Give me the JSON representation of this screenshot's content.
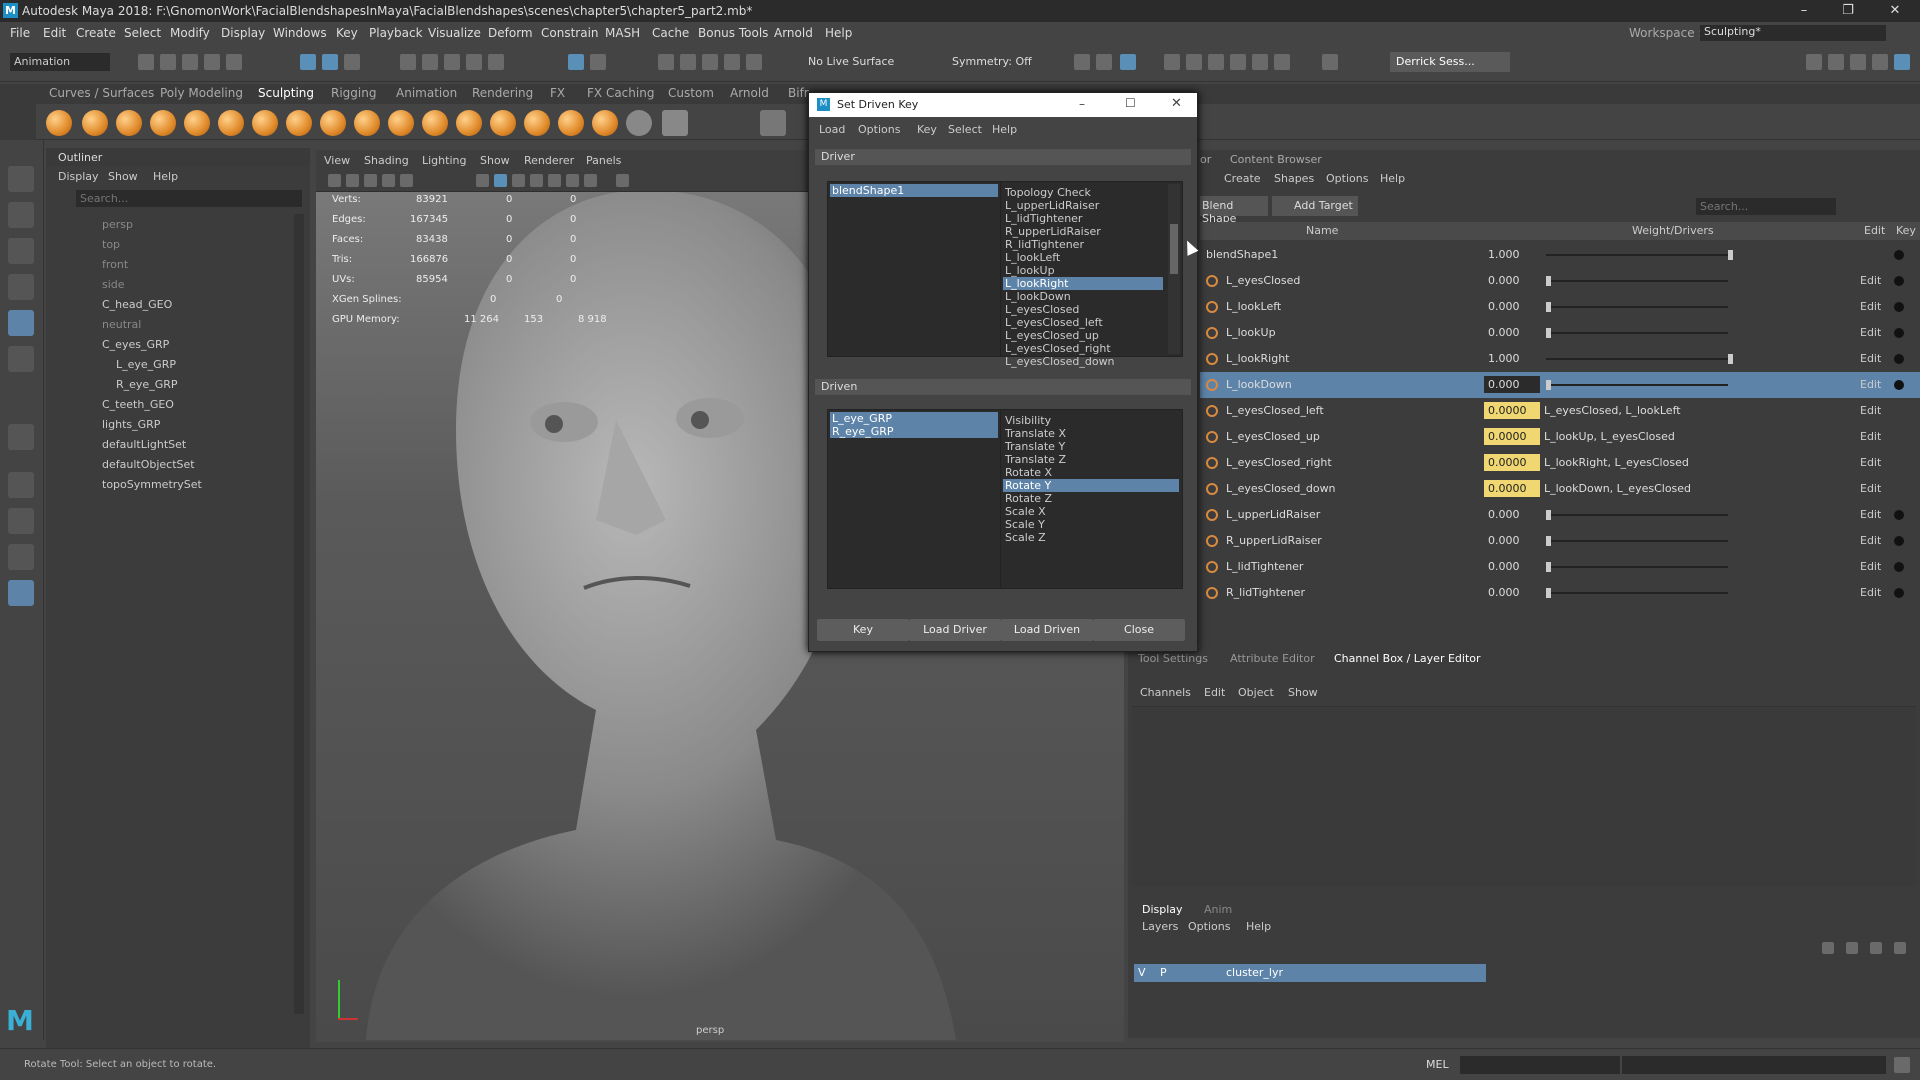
{
  "titlebar": {
    "title": "Autodesk Maya 2018: F:\\GnomonWork\\FacialBlendshapesInMaya\\FacialBlendshapes\\scenes\\chapter5\\chapter5_part2.mb*",
    "minimize": "–",
    "maximize": "❐",
    "close": "✕"
  },
  "menubar": [
    "File",
    "Edit",
    "Create",
    "Select",
    "Modify",
    "Display",
    "Windows",
    "Key",
    "Playback",
    "Visualize",
    "Deform",
    "Constrain",
    "MASH",
    "Cache",
    "Bonus Tools",
    "Arnold",
    "Help"
  ],
  "workspace": {
    "label": "Workspace :",
    "value": "Sculpting*"
  },
  "statusline": {
    "mode": "Animation",
    "live_surface": "No Live Surface",
    "symmetry": "Symmetry: Off",
    "user": "Derrick Sess..."
  },
  "shelf_tabs": [
    "Curves / Surfaces",
    "Poly Modeling",
    "Sculpting",
    "Rigging",
    "Animation",
    "Rendering",
    "FX",
    "FX Caching",
    "Custom",
    "Arnold",
    "Bifr"
  ],
  "outliner": {
    "title": "Outliner",
    "menu": [
      "Display",
      "Show",
      "Help"
    ],
    "search_placeholder": "Search...",
    "items": [
      "persp",
      "top",
      "front",
      "side",
      "C_head_GEO",
      "neutral",
      "C_eyes_GRP",
      "L_eye_GRP",
      "R_eye_GRP",
      "C_teeth_GEO",
      "lights_GRP",
      "defaultLightSet",
      "defaultObjectSet",
      "topoSymmetrySet"
    ]
  },
  "viewport": {
    "menu": [
      "View",
      "Shading",
      "Lighting",
      "Show",
      "Renderer",
      "Panels"
    ],
    "camera": "persp",
    "hud": [
      [
        "Verts:",
        "83921",
        "0",
        "0"
      ],
      [
        "Edges:",
        "167345",
        "0",
        "0"
      ],
      [
        "Faces:",
        "83438",
        "0",
        "0"
      ],
      [
        "Tris:",
        "166876",
        "0",
        "0"
      ],
      [
        "UVs:",
        "85954",
        "0",
        "0"
      ],
      [
        "XGen Splines:",
        "0",
        "0",
        ""
      ],
      [
        "GPU Memory:",
        "11 264",
        "153",
        "8 918"
      ]
    ]
  },
  "dialog": {
    "title": "Set Driven Key",
    "menu": [
      "Load",
      "Options",
      "Key",
      "Select",
      "Help"
    ],
    "driver_label": "Driver",
    "driver_objects": [
      "blendShape1"
    ],
    "driver_attrs": [
      "Topology Check",
      "L_upperLidRaiser",
      "L_lidTightener",
      "R_upperLidRaiser",
      "R_lidTightener",
      "L_lookLeft",
      "L_lookUp",
      "L_lookRight",
      "L_lookDown",
      "L_eyesClosed",
      "L_eyesClosed_left",
      "L_eyesClosed_up",
      "L_eyesClosed_right",
      "L_eyesClosed_down"
    ],
    "driven_label": "Driven",
    "driven_objects": [
      "L_eye_GRP",
      "R_eye_GRP"
    ],
    "driven_attrs": [
      "Visibility",
      "Translate X",
      "Translate Y",
      "Translate Z",
      "Rotate X",
      "Rotate Y",
      "Rotate Z",
      "Scale X",
      "Scale Y",
      "Scale Z"
    ],
    "buttons": [
      "Key",
      "Load Driver",
      "Load Driven",
      "Close"
    ]
  },
  "shape_editor": {
    "tabs": [
      "or",
      "Content Browser"
    ],
    "menu": [
      "Create",
      "Shapes",
      "Options",
      "Help"
    ],
    "blend_btn": "Blend Shape",
    "add_target": "Add Target",
    "search_placeholder": "Search...",
    "col_name": "Name",
    "col_weight": "Weight/Drivers",
    "col_edit": "Edit",
    "col_key": "Key",
    "rows": [
      {
        "name": "blendShape1",
        "value": "1.000",
        "slider": 1.0,
        "drivers": "",
        "edit": ""
      },
      {
        "name": "L_eyesClosed",
        "value": "0.000",
        "slider": 0,
        "drivers": "",
        "edit": "Edit"
      },
      {
        "name": "L_lookLeft",
        "value": "0.000",
        "slider": 0,
        "drivers": "",
        "edit": "Edit"
      },
      {
        "name": "L_lookUp",
        "value": "0.000",
        "slider": 0,
        "drivers": "",
        "edit": "Edit"
      },
      {
        "name": "L_lookRight",
        "value": "1.000",
        "slider": 1.0,
        "drivers": "",
        "edit": "Edit"
      },
      {
        "name": "L_lookDown",
        "value": "0.000",
        "slider": 0,
        "drivers": "",
        "edit": "Edit",
        "selected": true
      },
      {
        "name": "L_eyesClosed_left",
        "value": "0.0000",
        "drivers": "L_eyesClosed, L_lookLeft",
        "edit": "Edit",
        "driven": true
      },
      {
        "name": "L_eyesClosed_up",
        "value": "0.0000",
        "drivers": "L_lookUp, L_eyesClosed",
        "edit": "Edit",
        "driven": true
      },
      {
        "name": "L_eyesClosed_right",
        "value": "0.0000",
        "drivers": "L_lookRight, L_eyesClosed",
        "edit": "Edit",
        "driven": true
      },
      {
        "name": "L_eyesClosed_down",
        "value": "0.0000",
        "drivers": "L_lookDown, L_eyesClosed",
        "edit": "Edit",
        "driven": true
      },
      {
        "name": "L_upperLidRaiser",
        "value": "0.000",
        "slider": 0,
        "drivers": "",
        "edit": "Edit"
      },
      {
        "name": "R_upperLidRaiser",
        "value": "0.000",
        "slider": 0,
        "drivers": "",
        "edit": "Edit"
      },
      {
        "name": "L_lidTightener",
        "value": "0.000",
        "slider": 0,
        "drivers": "",
        "edit": "Edit"
      },
      {
        "name": "R_lidTightener",
        "value": "0.000",
        "slider": 0,
        "drivers": "",
        "edit": "Edit"
      }
    ]
  },
  "channel": {
    "tabs": [
      "Tool Settings",
      "Attribute Editor",
      "Channel Box / Layer Editor"
    ],
    "menu": [
      "Channels",
      "Edit",
      "Object",
      "Show"
    ],
    "layer_tabs": [
      "Display",
      "Anim"
    ],
    "layer_menu": [
      "Layers",
      "Options",
      "Help"
    ],
    "layer": {
      "v": "V",
      "p": "P",
      "name": "cluster_lyr"
    }
  },
  "bottom": {
    "help": "Rotate Tool: Select an object to rotate.",
    "mel": "MEL"
  },
  "colors": {
    "accent": "#5d83a8",
    "driven_value": "#f0d772",
    "icon_orange": "#e08a2a"
  }
}
